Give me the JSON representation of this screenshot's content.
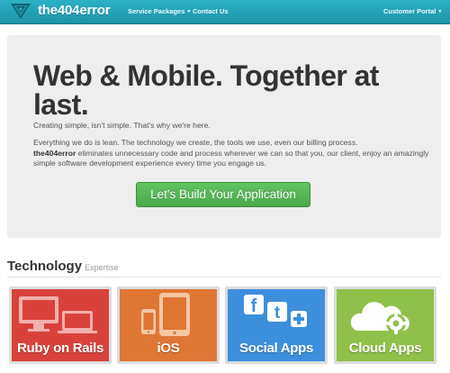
{
  "nav": {
    "brand": "the404error",
    "links": [
      {
        "label": "Service Packages",
        "dropdown": true
      },
      {
        "label": "Contact Us",
        "dropdown": false
      },
      {
        "label": "Customer Portal",
        "dropdown": true
      }
    ]
  },
  "hero": {
    "title": "Web & Mobile. Together at last.",
    "subtitle": "Creating simple, isn't simple. That's why we're here.",
    "body_line1": "Everything we do is lean. The technology we create, the tools we use, even our billing process.",
    "body_brand": "the404error",
    "body_rest": " eliminates unnecessary code and process wherever we can so that you, our client, enjoy an amazingly simple software development experience every time you engage us.",
    "cta_label": "Let's Build Your Application"
  },
  "technology": {
    "heading": "Technology",
    "subheading": "Expertise",
    "tiles": [
      {
        "label": "Ruby on Rails",
        "icon": "devices-icon",
        "color": "#d9423b"
      },
      {
        "label": "iOS",
        "icon": "ios-devices-icon",
        "color": "#e07634"
      },
      {
        "label": "Social Apps",
        "icon": "social-icon",
        "color": "#3d8fde"
      },
      {
        "label": "Cloud Apps",
        "icon": "cloud-gear-icon",
        "color": "#8fc14a"
      }
    ]
  },
  "colors": {
    "navbar": "#26a6bb",
    "cta": "#55b655",
    "hero_bg": "#eeeeee"
  }
}
